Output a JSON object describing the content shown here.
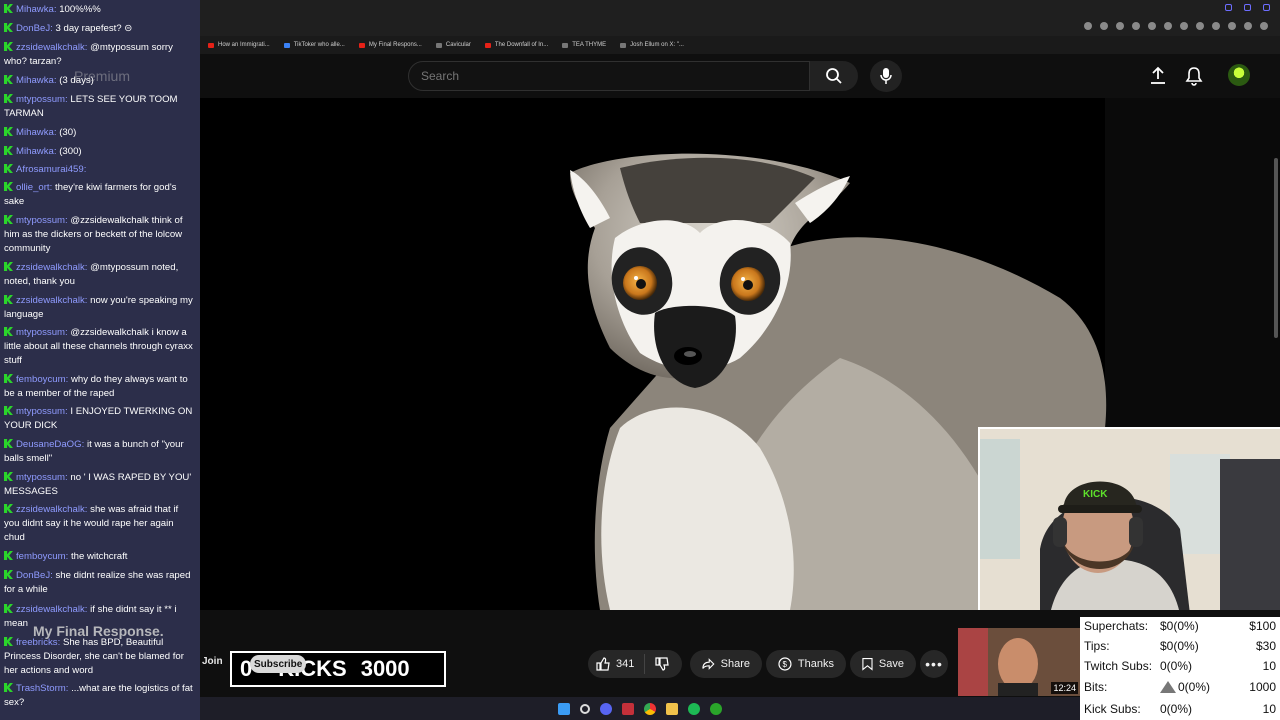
{
  "browser": {
    "bookmarks": [
      "How an Immigrati...",
      "TikToker who alle...",
      "My Final Respons...",
      "Cavicular",
      "The Downfall of In...",
      "TEA THYME",
      "Josh Ellum on X: \"..."
    ]
  },
  "header": {
    "search_placeholder": "Search",
    "premium_label": "Premium"
  },
  "chat": {
    "messages": [
      {
        "user": "Mihawka",
        "text": "100%%%"
      },
      {
        "user": "DonBeJ",
        "text": "3 day rapefest? ⊝"
      },
      {
        "user": "zzsidewalkchalk",
        "text": "@mtypossum sorry who? tarzan?"
      },
      {
        "user": "Mihawka",
        "text": "(3 days)"
      },
      {
        "user": "mtypossum",
        "text": "LETS SEE YOUR TOOM TARMAN"
      },
      {
        "user": "Mihawka",
        "text": "(30)"
      },
      {
        "user": "Mihawka",
        "text": "(300)"
      },
      {
        "user": "Afrosamurai459",
        "text": ""
      },
      {
        "user": "ollie_ort",
        "text": "they're kiwi farmers for god's sake"
      },
      {
        "user": "mtypossum",
        "text": "@zzsidewalkchalk think of him as the dickers or beckett of the lolcow community"
      },
      {
        "user": "zzsidewalkchalk",
        "text": "@mtypossum noted, noted, thank you"
      },
      {
        "user": "zzsidewalkchalk",
        "text": "now you're speaking my language"
      },
      {
        "user": "mtypossum",
        "text": "@zzsidewalkchalk i know a little about all these channels through cyraxx stuff"
      },
      {
        "user": "femboycum",
        "text": "why do they always want to be a member of the raped"
      },
      {
        "user": "mtypossum",
        "text": "I ENJOYED TWERKING ON YOUR DICK"
      },
      {
        "user": "DeusaneDaOG",
        "text": "it was a bunch of \"your balls smell\""
      },
      {
        "user": "mtypossum",
        "text": "no ' I WAS RAPED BY YOU' MESSAGES"
      },
      {
        "user": "zzsidewalkchalk",
        "text": "she was afraid that if you didnt say it he would rape her again chud"
      },
      {
        "user": "femboycum",
        "text": "the witchcraft"
      },
      {
        "user": "DonBeJ",
        "text": "she didnt realize she was raped for a while"
      },
      {
        "user": "zzsidewalkchalk",
        "text": "if she didnt say it ** i mean"
      },
      {
        "user": "freebricks",
        "text": "She has BPD, Beautiful Princess Disorder, she can't be blamed for her actions and word"
      },
      {
        "user": "TrashStorm",
        "text": "...what are the logistics of fat sex?"
      }
    ]
  },
  "video": {
    "channel_title": "My Final Response.",
    "join_label": "Join",
    "subscribe_label": "Subscribe",
    "kicks_prefix": "0",
    "kicks_label": "KICKS",
    "kicks_goal": "3000",
    "like_count": "341",
    "share_label": "Share",
    "thanks_label": "Thanks",
    "save_label": "Save",
    "up_next_duration": "12:24",
    "webcam_cap_text": "KICK"
  },
  "stats": [
    {
      "label": "Superchats:",
      "value": "$0(0%)",
      "goal": "$100"
    },
    {
      "label": "Tips:",
      "value": "$0(0%)",
      "goal": "$30"
    },
    {
      "label": "Twitch Subs:",
      "value": "0(0%)",
      "goal": "10"
    },
    {
      "label": "Bits:",
      "value": "0(0%)",
      "goal": "1000"
    },
    {
      "label": "Kick Subs:",
      "value": "0(0%)",
      "goal": "10"
    }
  ],
  "colors": {
    "chat_bg": "#2c2e4a",
    "username": "#8f9bff",
    "badge_green": "#2bd52b",
    "yt_bg": "#0f0f0f"
  }
}
